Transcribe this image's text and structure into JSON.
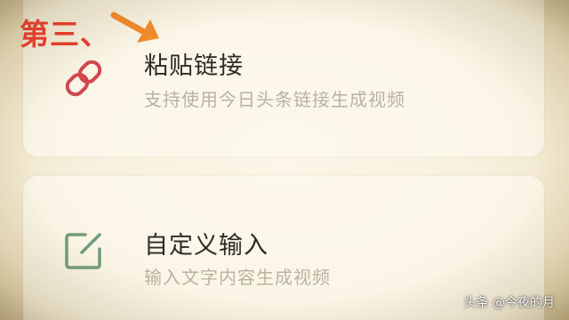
{
  "annotation": {
    "step_label": "第三、"
  },
  "options": [
    {
      "title": "粘贴链接",
      "description": "支持使用今日头条链接生成视频",
      "icon": "link-icon"
    },
    {
      "title": "自定义输入",
      "description": "输入文字内容生成视频",
      "icon": "edit-icon"
    }
  ],
  "watermark": {
    "text": "头条 @今夜的月"
  },
  "colors": {
    "annotation_red": "#ee3a2d",
    "annotation_arrow": "#f38a2a",
    "link_icon": "#d2474d",
    "edit_icon": "#6f9c78",
    "title_text": "#2c2a24",
    "description_text": "#b9b2a2"
  }
}
